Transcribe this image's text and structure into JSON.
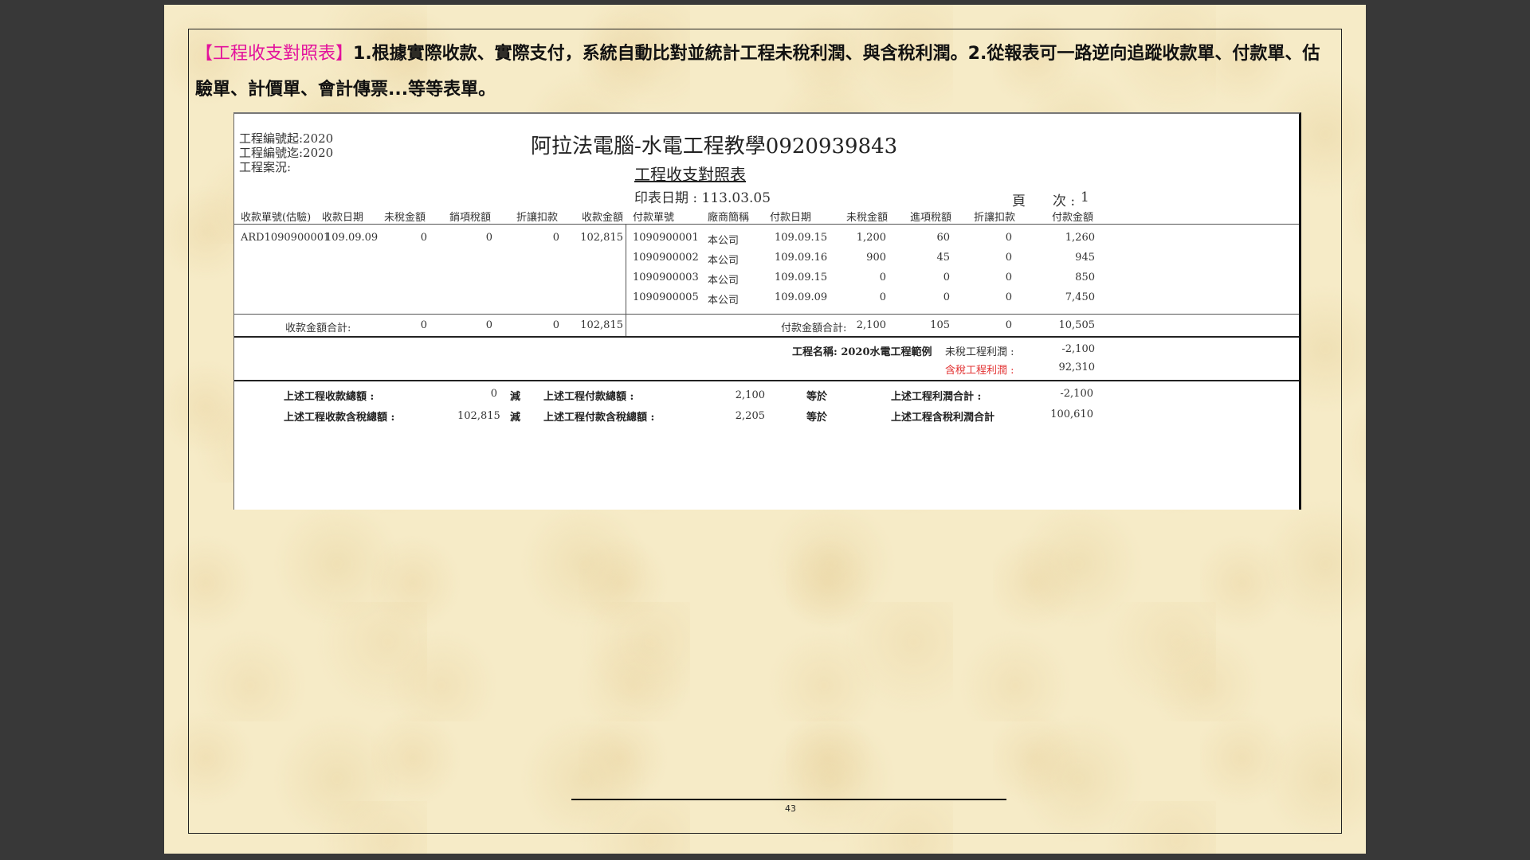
{
  "intro": {
    "tag": "【工程收支對照表】",
    "text": "1.根據實際收款、實際支付，系統自動比對並統計工程未稅利潤、與含稅利潤。2.從報表可一路逆向追蹤收款單、付款單、估驗單、計價單、會計傳票...等等表單。"
  },
  "report": {
    "company_title": "阿拉法電腦-水電工程教學0920939843",
    "report_title": "工程收支對照表",
    "print_date": "印表日期 : 113.03.05",
    "page_label": "頁　　次 :",
    "page_no": "1",
    "filters": [
      "工程編號起:2020",
      "工程編號迄:2020",
      "工程案況:"
    ],
    "receipt_headers": [
      "收款單號(估驗)",
      "收款日期",
      "未稅金額",
      "銷項稅額",
      "折讓扣款",
      "收款金額"
    ],
    "payment_headers": [
      "付款單號",
      "廠商簡稱",
      "付款日期",
      "未稅金額",
      "進項稅額",
      "折讓扣款",
      "付款金額"
    ],
    "receipt_rows": [
      {
        "no": "ARD1090900001",
        "date": "109.09.09",
        "net": "0",
        "tax": "0",
        "discount": "0",
        "amount": "102,815"
      }
    ],
    "payment_rows": [
      {
        "no": "1090900001",
        "vendor": "本公司",
        "date": "109.09.15",
        "net": "1,200",
        "tax": "60",
        "discount": "0",
        "amount": "1,260"
      },
      {
        "no": "1090900002",
        "vendor": "本公司",
        "date": "109.09.16",
        "net": "900",
        "tax": "45",
        "discount": "0",
        "amount": "945"
      },
      {
        "no": "1090900003",
        "vendor": "本公司",
        "date": "109.09.15",
        "net": "0",
        "tax": "0",
        "discount": "0",
        "amount": "850"
      },
      {
        "no": "1090900005",
        "vendor": "本公司",
        "date": "109.09.09",
        "net": "0",
        "tax": "0",
        "discount": "0",
        "amount": "7,450"
      }
    ],
    "receipt_total": {
      "label": "收款金額合計:",
      "net": "0",
      "tax": "0",
      "discount": "0",
      "amount": "102,815"
    },
    "payment_total": {
      "label": "付款金額合計:",
      "net": "2,100",
      "tax": "105",
      "discount": "0",
      "amount": "10,505"
    },
    "project": {
      "name_label": "工程名稱: 2020水電工程範例",
      "untaxed_label": "未稅工程利潤 :",
      "untaxed_value": "-2,100",
      "taxed_label": "含稅工程利潤 :",
      "taxed_value": "92,310"
    },
    "summary": {
      "row1": {
        "label1": "上述工程收款總額 :",
        "v1": "0",
        "minus": "減",
        "label2": "上述工程付款總額 :",
        "v2": "2,100",
        "eq": "等於",
        "label3": "上述工程利潤合計 :",
        "v3": "-2,100"
      },
      "row2": {
        "label1": "上述工程收款含稅總額 :",
        "v1": "102,815",
        "minus": "減",
        "label2": "上述工程付款含稅總額 :",
        "v2": "2,205",
        "eq": "等於",
        "label3": "上述工程含稅利潤合計",
        "v3": "100,610"
      }
    }
  },
  "footer": {
    "page_number": "43"
  }
}
